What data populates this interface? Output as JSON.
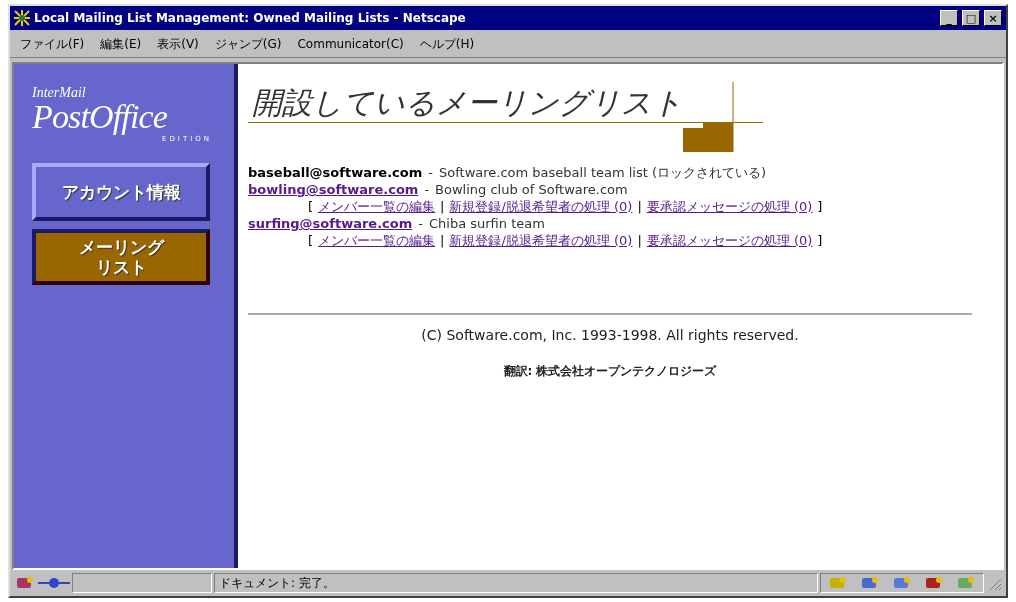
{
  "window": {
    "title": "Local Mailing List Management: Owned Mailing Lists - Netscape",
    "controls": [
      "_",
      "□",
      "×"
    ]
  },
  "menu": [
    "ファイル(F)",
    "編集(E)",
    "表示(V)",
    "ジャンプ(G)",
    "Communicator(C)",
    "ヘルプ(H)"
  ],
  "sidebar": {
    "logo": {
      "top": "InterMail",
      "main": "PostOffice",
      "sub": "EDITION"
    },
    "nav": [
      {
        "label": [
          "アカウント情報"
        ],
        "selected": false
      },
      {
        "label": [
          "メーリング",
          "リスト"
        ],
        "selected": true
      }
    ]
  },
  "heading": "開設しているメーリングリスト",
  "lists": [
    {
      "address": "baseball@software.com",
      "locked": true,
      "description": "Software.com baseball team list (ロックされている)"
    },
    {
      "address": "bowling@software.com",
      "locked": false,
      "description": "Bowling club of Software.com",
      "actions": [
        "メンバー一覧の編集",
        "新規登録/脱退希望者の処理 (0)",
        "要承認メッセージの処理 (0)"
      ]
    },
    {
      "address": "surfing@software.com",
      "locked": false,
      "description": "Chiba surfin team",
      "actions": [
        "メンバー一覧の編集",
        "新規登録/脱退希望者の処理 (0)",
        "要承認メッセージの処理 (0)"
      ]
    }
  ],
  "separators": {
    "dash": "-",
    "open": "[",
    "between": "|",
    "close": "]"
  },
  "footer": {
    "copyright": "(C) Software.com, Inc. 1993-1998. All rights reserved.",
    "translation": "翻訳: 株式会社オープンテクノロジーズ"
  },
  "status_bar": {
    "text": "ドキュメント: 完了。"
  }
}
